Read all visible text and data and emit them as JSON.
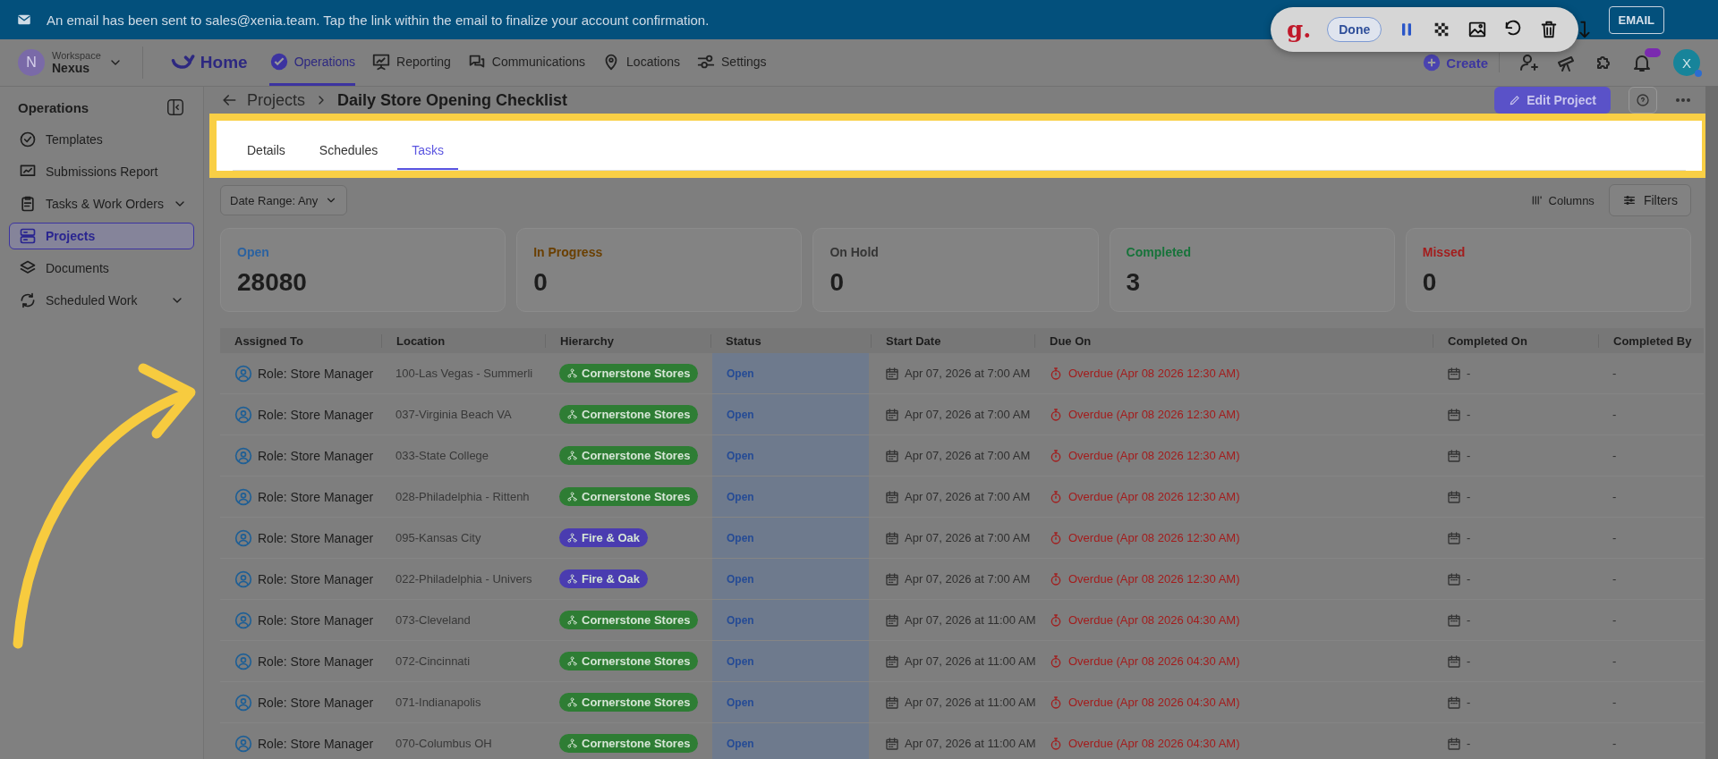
{
  "banner": {
    "message": "An email has been sent to sales@xenia.team. Tap the link within the email to finalize your account confirmation.",
    "button": "EMAIL"
  },
  "recorder_toolbar": {
    "logo": "g.",
    "done": "Done"
  },
  "nav": {
    "avatar": "N",
    "workspace_label": "Workspace",
    "workspace_name": "Nexus",
    "home": "Home",
    "items": [
      {
        "label": "Operations",
        "selected": true
      },
      {
        "label": "Reporting",
        "selected": false
      },
      {
        "label": "Communications",
        "selected": false
      },
      {
        "label": "Locations",
        "selected": false
      },
      {
        "label": "Settings",
        "selected": false
      }
    ],
    "create": "Create",
    "user_avatar": "X"
  },
  "sidebar": {
    "title": "Operations",
    "items": [
      {
        "label": "Templates",
        "selected": false,
        "expandable": false
      },
      {
        "label": "Submissions Report",
        "selected": false,
        "expandable": false
      },
      {
        "label": "Tasks & Work Orders",
        "selected": false,
        "expandable": true
      },
      {
        "label": "Projects",
        "selected": true,
        "expandable": false
      },
      {
        "label": "Documents",
        "selected": false,
        "expandable": false
      },
      {
        "label": "Scheduled Work",
        "selected": false,
        "expandable": true
      }
    ]
  },
  "breadcrumb": {
    "parent": "Projects",
    "current": "Daily Store Opening Checklist"
  },
  "edit_button": "Edit Project",
  "tabs": [
    {
      "label": "Details",
      "selected": false
    },
    {
      "label": "Schedules",
      "selected": false
    },
    {
      "label": "Tasks",
      "selected": true
    }
  ],
  "date_range": "Date Range: Any",
  "columns_button": "Columns",
  "filters_button": "Filters",
  "stats": [
    {
      "label": "Open",
      "value": "28080",
      "color": "#2b62a0"
    },
    {
      "label": "In Progress",
      "value": "0",
      "color": "#6a3f00"
    },
    {
      "label": "On Hold",
      "value": "0",
      "color": "#353535"
    },
    {
      "label": "Completed",
      "value": "3",
      "color": "#17733a"
    },
    {
      "label": "Missed",
      "value": "0",
      "color": "#a31c1c"
    }
  ],
  "table": {
    "columns": [
      "Assigned To",
      "Location",
      "Hierarchy",
      "Status",
      "Start Date",
      "Due On",
      "Completed On",
      "Completed By"
    ],
    "rows": [
      {
        "assigned_to": "Role: Store Manager",
        "location": "100-Las Vegas - Summerli",
        "hierarchy": {
          "label": "Cornerstone Stores",
          "color": "#2e7d34"
        },
        "status": "Open",
        "start_date": "Apr 07, 2026 at 7:00 AM",
        "due_on": "Overdue (Apr 08 2026 12:30 AM)",
        "completed_on": "-",
        "completed_by": "-"
      },
      {
        "assigned_to": "Role: Store Manager",
        "location": "037-Virginia Beach VA",
        "hierarchy": {
          "label": "Cornerstone Stores",
          "color": "#2e7d34"
        },
        "status": "Open",
        "start_date": "Apr 07, 2026 at 7:00 AM",
        "due_on": "Overdue (Apr 08 2026 12:30 AM)",
        "completed_on": "-",
        "completed_by": "-"
      },
      {
        "assigned_to": "Role: Store Manager",
        "location": "033-State College",
        "hierarchy": {
          "label": "Cornerstone Stores",
          "color": "#2e7d34"
        },
        "status": "Open",
        "start_date": "Apr 07, 2026 at 7:00 AM",
        "due_on": "Overdue (Apr 08 2026 12:30 AM)",
        "completed_on": "-",
        "completed_by": "-"
      },
      {
        "assigned_to": "Role: Store Manager",
        "location": "028-Philadelphia - Rittenh",
        "hierarchy": {
          "label": "Cornerstone Stores",
          "color": "#2e7d34"
        },
        "status": "Open",
        "start_date": "Apr 07, 2026 at 7:00 AM",
        "due_on": "Overdue (Apr 08 2026 12:30 AM)",
        "completed_on": "-",
        "completed_by": "-"
      },
      {
        "assigned_to": "Role: Store Manager",
        "location": "095-Kansas City",
        "hierarchy": {
          "label": "Fire & Oak",
          "color": "#4a3cb0"
        },
        "status": "Open",
        "start_date": "Apr 07, 2026 at 7:00 AM",
        "due_on": "Overdue (Apr 08 2026 12:30 AM)",
        "completed_on": "-",
        "completed_by": "-"
      },
      {
        "assigned_to": "Role: Store Manager",
        "location": "022-Philadelphia - Univers",
        "hierarchy": {
          "label": "Fire & Oak",
          "color": "#4a3cb0"
        },
        "status": "Open",
        "start_date": "Apr 07, 2026 at 7:00 AM",
        "due_on": "Overdue (Apr 08 2026 12:30 AM)",
        "completed_on": "-",
        "completed_by": "-"
      },
      {
        "assigned_to": "Role: Store Manager",
        "location": "073-Cleveland",
        "hierarchy": {
          "label": "Cornerstone Stores",
          "color": "#2e7d34"
        },
        "status": "Open",
        "start_date": "Apr 07, 2026 at 11:00 AM",
        "due_on": "Overdue (Apr 08 2026 04:30 AM)",
        "completed_on": "-",
        "completed_by": "-"
      },
      {
        "assigned_to": "Role: Store Manager",
        "location": "072-Cincinnati",
        "hierarchy": {
          "label": "Cornerstone Stores",
          "color": "#2e7d34"
        },
        "status": "Open",
        "start_date": "Apr 07, 2026 at 11:00 AM",
        "due_on": "Overdue (Apr 08 2026 04:30 AM)",
        "completed_on": "-",
        "completed_by": "-"
      },
      {
        "assigned_to": "Role: Store Manager",
        "location": "071-Indianapolis",
        "hierarchy": {
          "label": "Cornerstone Stores",
          "color": "#2e7d34"
        },
        "status": "Open",
        "start_date": "Apr 07, 2026 at 11:00 AM",
        "due_on": "Overdue (Apr 08 2026 04:30 AM)",
        "completed_on": "-",
        "completed_by": "-"
      },
      {
        "assigned_to": "Role: Store Manager",
        "location": "070-Columbus OH",
        "hierarchy": {
          "label": "Cornerstone Stores",
          "color": "#2e7d34"
        },
        "status": "Open",
        "start_date": "Apr 07, 2026 at 11:00 AM",
        "due_on": "Overdue (Apr 08 2026 04:30 AM)",
        "completed_on": "-",
        "completed_by": "-"
      }
    ]
  }
}
